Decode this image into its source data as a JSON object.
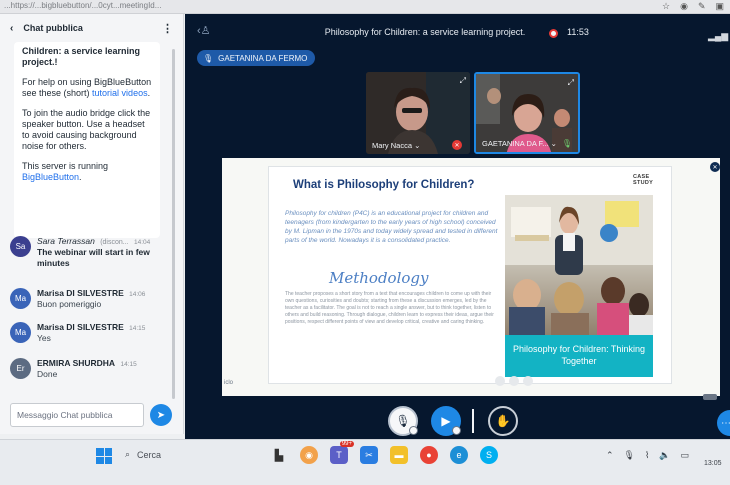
{
  "browser": {
    "url_fragment": "...https://...bigbluebutton/...0cyt...meetingId...",
    "icons": [
      "star-icon",
      "extension-icon",
      "pencil-icon",
      "puzzle-icon"
    ]
  },
  "chat": {
    "title": "Chat pubblica",
    "welcome": {
      "line1": "Children: a service learning project.!",
      "help_prefix": "For help on using BigBlueButton see these (short)",
      "help_link": "tutorial videos",
      "help_suffix": ".",
      "audio": "To join the audio bridge click the speaker button. Use a headset to avoid causing background noise for others.",
      "server_prefix": "This server is running",
      "server_link": "BigBlueButton",
      "server_suffix": "."
    },
    "messages": [
      {
        "initials": "Sa",
        "name": "Sara Terrassan",
        "suffix": "(discon...",
        "time": "14:04",
        "text": "The webinar will start in few minutes",
        "color": "#3b3f8f"
      },
      {
        "initials": "Ma",
        "name": "Marisa DI SILVESTRE",
        "suffix": "",
        "time": "14:06",
        "text": "Buon pomeriggio",
        "color": "#3a64b8"
      },
      {
        "initials": "Ma",
        "name": "Marisa DI SILVESTRE",
        "suffix": "",
        "time": "14:15",
        "text": "Yes",
        "color": "#3a64b8"
      },
      {
        "initials": "Er",
        "name": "ERMIRA SHURDHA",
        "suffix": "",
        "time": "14:15",
        "text": "Done",
        "color": "#5c6b82"
      }
    ],
    "input_placeholder": "Messaggio Chat pubblica"
  },
  "meeting": {
    "title": "Philosophy for Children: a service learning project.",
    "recording_time": "11:53",
    "talking": "GAETANINA DA FERMO",
    "videos": [
      {
        "label": "Mary Nacca",
        "mic": "muted"
      },
      {
        "label": "GAETANINA DA F...",
        "mic": "on"
      }
    ]
  },
  "slide": {
    "case_study": "CASE STUDY",
    "heading": "What is Philosophy for Children?",
    "intro": "Philosophy for children (P4C) is an educational project for children and teenagers (from kindergarten to the early years of high school) conceived by M. Lipman in the 1970s and today widely spread and tested in different parts of the world. Nowadays it is a consolidated practice.",
    "methodology": "Methodology",
    "body": "The teacher proposes a short story from a text that encourages children to come up with their own questions, curiosities and doubts; starting from these a discussion emerges, led by the teacher as a facilitator. The goal is not to reach a single answer, but to think together, listen to others and build reasoning. Through dialogue, children learn to express their ideas, argue their positions, respect different points of view and develop critical, creative and caring thinking.",
    "caption": "Philosophy for Children: Thinking Together",
    "logo": "iclo"
  },
  "taskbar": {
    "search": "Cerca",
    "notification_badge": "99+",
    "clock": "13:05"
  },
  "colors": {
    "meeting_bg": "#06172e",
    "accent_blue": "#1e88e5",
    "caption_teal": "#13b3c4",
    "heading_navy": "#1d3f79"
  }
}
